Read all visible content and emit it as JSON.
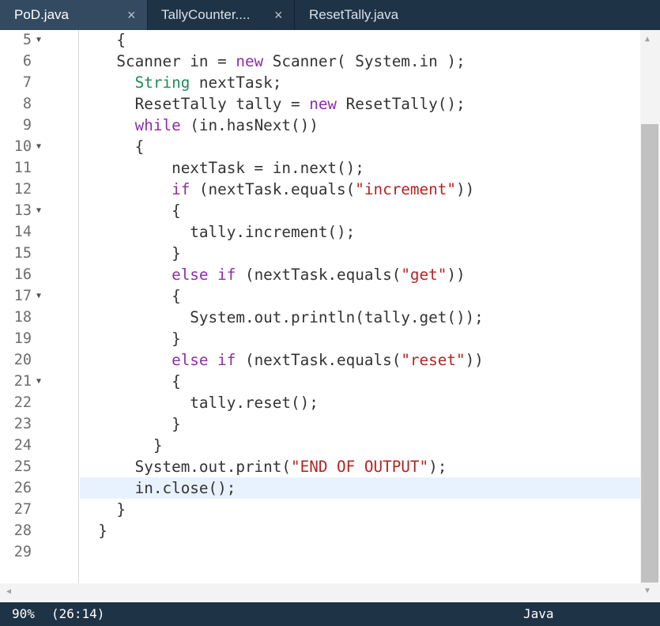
{
  "tabs": [
    {
      "label": "PoD.java",
      "active": true
    },
    {
      "label": "TallyCounter....",
      "active": false
    },
    {
      "label": "ResetTally.java",
      "active": false
    }
  ],
  "tab_close_glyph": "×",
  "icons": {
    "fold": "triangle-down-icon",
    "close": "close-icon"
  },
  "editor": {
    "lines": [
      {
        "n": "5",
        "fold": true,
        "tokens": [
          [
            "",
            "    {"
          ]
        ]
      },
      {
        "n": "6",
        "fold": false,
        "tokens": [
          [
            "",
            "    Scanner in = "
          ],
          [
            "kw",
            "new"
          ],
          [
            "",
            " Scanner( System.in );"
          ]
        ]
      },
      {
        "n": "7",
        "fold": false,
        "tokens": [
          [
            "",
            "      "
          ],
          [
            "ty",
            "String"
          ],
          [
            "",
            " nextTask;"
          ]
        ]
      },
      {
        "n": "8",
        "fold": false,
        "tokens": [
          [
            "",
            "      ResetTally tally = "
          ],
          [
            "kw",
            "new"
          ],
          [
            "",
            " ResetTally();"
          ]
        ]
      },
      {
        "n": "9",
        "fold": false,
        "tokens": [
          [
            "",
            "      "
          ],
          [
            "kw",
            "while"
          ],
          [
            "",
            " (in.hasNext())"
          ]
        ]
      },
      {
        "n": "10",
        "fold": true,
        "tokens": [
          [
            "",
            "      {"
          ]
        ]
      },
      {
        "n": "11",
        "fold": false,
        "tokens": [
          [
            "",
            "          nextTask = in.next();"
          ]
        ]
      },
      {
        "n": "12",
        "fold": false,
        "tokens": [
          [
            "",
            "          "
          ],
          [
            "kw",
            "if"
          ],
          [
            "",
            " (nextTask.equals("
          ],
          [
            "st",
            "\"increment\""
          ],
          [
            "",
            "))"
          ]
        ]
      },
      {
        "n": "13",
        "fold": true,
        "tokens": [
          [
            "",
            "          {"
          ]
        ]
      },
      {
        "n": "14",
        "fold": false,
        "tokens": [
          [
            "",
            "            tally.increment();"
          ]
        ]
      },
      {
        "n": "15",
        "fold": false,
        "tokens": [
          [
            "",
            "          }"
          ]
        ]
      },
      {
        "n": "16",
        "fold": false,
        "tokens": [
          [
            "",
            "          "
          ],
          [
            "kw",
            "else"
          ],
          [
            "",
            " "
          ],
          [
            "kw",
            "if"
          ],
          [
            "",
            " (nextTask.equals("
          ],
          [
            "st",
            "\"get\""
          ],
          [
            "",
            "))"
          ]
        ]
      },
      {
        "n": "17",
        "fold": true,
        "tokens": [
          [
            "",
            "          {"
          ]
        ]
      },
      {
        "n": "18",
        "fold": false,
        "tokens": [
          [
            "",
            "            System.out.println(tally.get());"
          ]
        ]
      },
      {
        "n": "19",
        "fold": false,
        "tokens": [
          [
            "",
            "          }"
          ]
        ]
      },
      {
        "n": "20",
        "fold": false,
        "tokens": [
          [
            "",
            "          "
          ],
          [
            "kw",
            "else"
          ],
          [
            "",
            " "
          ],
          [
            "kw",
            "if"
          ],
          [
            "",
            " (nextTask.equals("
          ],
          [
            "st",
            "\"reset\""
          ],
          [
            "",
            "))"
          ]
        ]
      },
      {
        "n": "21",
        "fold": true,
        "tokens": [
          [
            "",
            "          {"
          ]
        ]
      },
      {
        "n": "22",
        "fold": false,
        "tokens": [
          [
            "",
            "            tally.reset();"
          ]
        ]
      },
      {
        "n": "23",
        "fold": false,
        "tokens": [
          [
            "",
            "          }"
          ]
        ]
      },
      {
        "n": "24",
        "fold": false,
        "tokens": [
          [
            "",
            "        }"
          ]
        ]
      },
      {
        "n": "25",
        "fold": false,
        "tokens": [
          [
            "",
            "      System.out.print("
          ],
          [
            "st",
            "\"END OF OUTPUT\""
          ],
          [
            "",
            ");"
          ]
        ]
      },
      {
        "n": "26",
        "fold": false,
        "active": true,
        "tokens": [
          [
            "",
            "      in.close();"
          ]
        ]
      },
      {
        "n": "27",
        "fold": false,
        "tokens": [
          [
            "",
            "    }"
          ]
        ]
      },
      {
        "n": "28",
        "fold": false,
        "tokens": [
          [
            "",
            "  }"
          ]
        ]
      },
      {
        "n": "29",
        "fold": false,
        "tokens": [
          [
            "",
            ""
          ]
        ]
      }
    ]
  },
  "status": {
    "zoom": "90%",
    "cursor": "(26:14)",
    "language": "Java"
  },
  "colors": {
    "keyword": "#8e2ea8",
    "type": "#1f8c5a",
    "string": "#b32424",
    "chrome": "#1f3346"
  }
}
